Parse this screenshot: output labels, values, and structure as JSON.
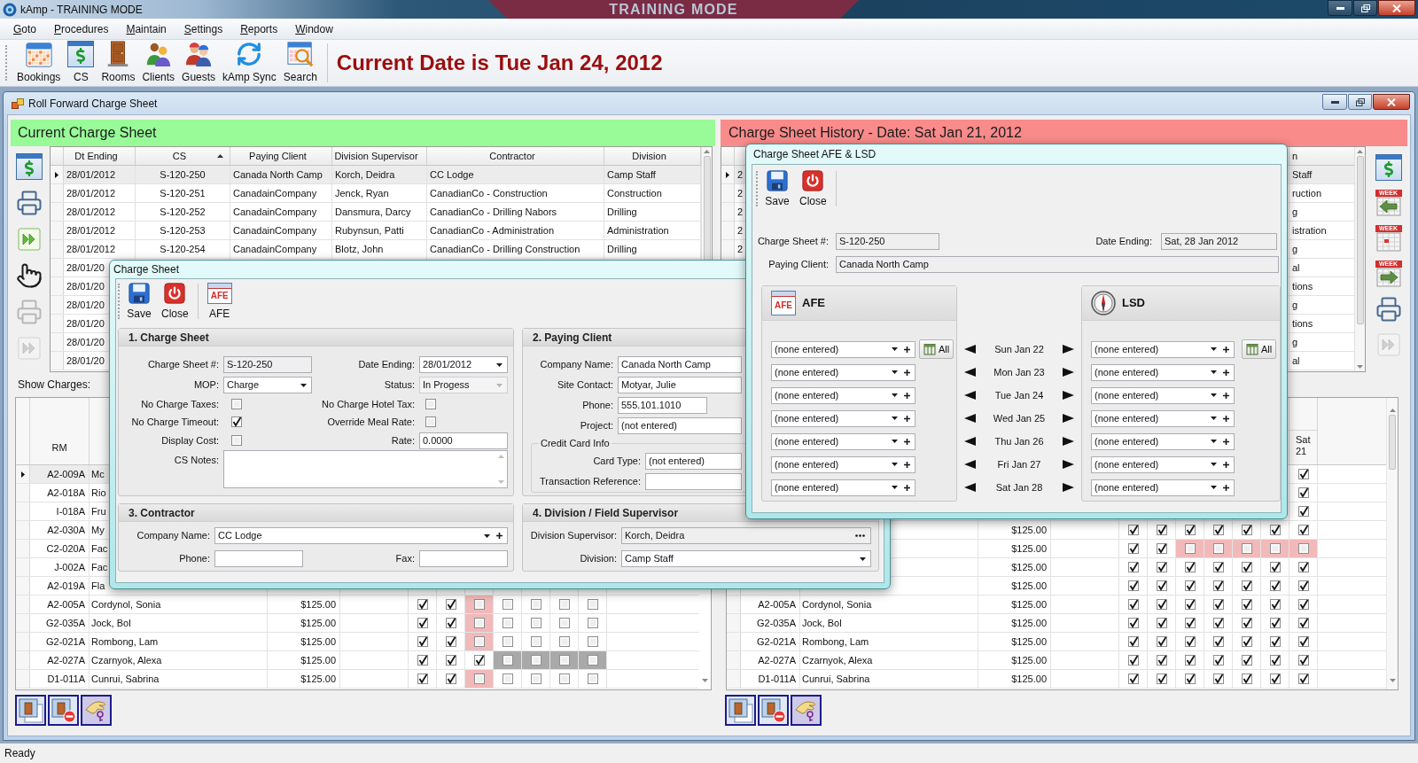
{
  "app": {
    "title": "kAmp - TRAINING MODE",
    "banner": "TRAINING MODE"
  },
  "menu": [
    {
      "label": "Goto"
    },
    {
      "label": "Procedures"
    },
    {
      "label": "Maintain"
    },
    {
      "label": "Settings"
    },
    {
      "label": "Reports"
    },
    {
      "label": "Window"
    }
  ],
  "toolbar": [
    {
      "kind": "calendar",
      "label": "Bookings"
    },
    {
      "kind": "sheet",
      "label": "CS"
    },
    {
      "kind": "door",
      "label": "Rooms"
    },
    {
      "kind": "people",
      "label": "Clients"
    },
    {
      "kind": "worker",
      "label": "Guests"
    },
    {
      "kind": "sync",
      "label": "kAmp Sync"
    },
    {
      "kind": "search",
      "label": "Search"
    }
  ],
  "current_date": "Current Date is Tue Jan 24, 2012",
  "child_window": {
    "title": "Roll Forward Charge Sheet"
  },
  "current_panel": {
    "title": "Current Charge Sheet",
    "side_tools": [
      {
        "kind": "sheet",
        "disabled": false
      },
      {
        "kind": "printer",
        "disabled": false
      },
      {
        "kind": "forward",
        "disabled": false
      },
      {
        "kind": "hand",
        "disabled": false
      },
      {
        "kind": "printer",
        "disabled": true
      },
      {
        "kind": "forward",
        "disabled": true
      }
    ],
    "table": {
      "columns": [
        {
          "label": "Dt Ending",
          "sorted": false
        },
        {
          "label": "CS",
          "sorted": true
        },
        {
          "label": "Paying Client",
          "sorted": false
        },
        {
          "label": "Division Supervisor",
          "sorted": false
        },
        {
          "label": "Contractor",
          "sorted": false
        },
        {
          "label": "Division",
          "sorted": false
        }
      ],
      "rows": [
        {
          "selected": true,
          "cells": [
            "28/01/2012",
            "S-120-250",
            "Canada North Camp",
            "Korch, Deidra",
            "CC Lodge",
            "Camp Staff"
          ]
        },
        {
          "selected": false,
          "cells": [
            "28/01/2012",
            "S-120-251",
            "CanadainCompany",
            "Jenck, Ryan",
            "CanadianCo - Construction",
            "Construction"
          ]
        },
        {
          "selected": false,
          "cells": [
            "28/01/2012",
            "S-120-252",
            "CanadainCompany",
            "Dansmura, Darcy",
            "CanadianCo - Drilling Nabors",
            "Drilling"
          ]
        },
        {
          "selected": false,
          "cells": [
            "28/01/2012",
            "S-120-253",
            "CanadainCompany",
            "Rubynsun, Patti",
            "CanadianCo - Administration",
            "Administration"
          ]
        },
        {
          "selected": false,
          "cells": [
            "28/01/2012",
            "S-120-254",
            "CanadainCompany",
            "Blotz, John",
            "CanadianCo - Drilling Construction",
            "Drilling"
          ]
        },
        {
          "selected": false,
          "cells": [
            "28/01/20"
          ]
        },
        {
          "selected": false,
          "cells": [
            "28/01/20"
          ]
        },
        {
          "selected": false,
          "cells": [
            "28/01/20"
          ]
        },
        {
          "selected": false,
          "cells": [
            "28/01/20"
          ]
        },
        {
          "selected": false,
          "cells": [
            "28/01/20"
          ]
        },
        {
          "selected": false,
          "cells": [
            "28/01/20"
          ]
        }
      ]
    },
    "show_charges": "Show Charges:",
    "grid": {
      "rm_header": "RM",
      "rows": [
        {
          "selected": true,
          "rm": "A2-009A",
          "name": "Mc"
        },
        {
          "selected": false,
          "rm": "A2-018A",
          "name": "Rio"
        },
        {
          "selected": false,
          "rm": "I-018A",
          "name": "Fru"
        },
        {
          "selected": false,
          "rm": "A2-030A",
          "name": "My"
        },
        {
          "selected": false,
          "rm": "C2-020A",
          "name": "Fac"
        },
        {
          "selected": false,
          "rm": "J-002A",
          "name": "Fac"
        },
        {
          "selected": false,
          "rm": "A2-019A",
          "name": "Fla"
        },
        {
          "selected": false,
          "rm": "A2-005A",
          "name": "Cordynol, Sonia",
          "amount": "$125.00",
          "checks": [
            {
              "checked": true,
              "flagged": false,
              "disabled": false
            },
            {
              "checked": true,
              "flagged": false,
              "disabled": false
            },
            {
              "checked": false,
              "flagged": true,
              "disabled": false
            },
            {
              "checked": false,
              "flagged": false,
              "disabled": false
            },
            {
              "checked": false,
              "flagged": false,
              "disabled": false
            },
            {
              "checked": false,
              "flagged": false,
              "disabled": false
            },
            {
              "checked": false,
              "flagged": false,
              "disabled": false
            }
          ]
        },
        {
          "selected": false,
          "rm": "G2-035A",
          "name": "Jock, Bol",
          "amount": "$125.00",
          "checks": [
            {
              "checked": true,
              "flagged": false,
              "disabled": false
            },
            {
              "checked": true,
              "flagged": false,
              "disabled": false
            },
            {
              "checked": false,
              "flagged": true,
              "disabled": false
            },
            {
              "checked": false,
              "flagged": false,
              "disabled": false
            },
            {
              "checked": false,
              "flagged": false,
              "disabled": false
            },
            {
              "checked": false,
              "flagged": false,
              "disabled": false
            },
            {
              "checked": false,
              "flagged": false,
              "disabled": false
            }
          ]
        },
        {
          "selected": false,
          "rm": "G2-021A",
          "name": "Rombong, Lam",
          "amount": "$125.00",
          "checks": [
            {
              "checked": true,
              "flagged": false,
              "disabled": false
            },
            {
              "checked": true,
              "flagged": false,
              "disabled": false
            },
            {
              "checked": false,
              "flagged": true,
              "disabled": false
            },
            {
              "checked": false,
              "flagged": false,
              "disabled": false
            },
            {
              "checked": false,
              "flagged": false,
              "disabled": false
            },
            {
              "checked": false,
              "flagged": false,
              "disabled": false
            },
            {
              "checked": false,
              "flagged": false,
              "disabled": false
            }
          ]
        },
        {
          "selected": false,
          "rm": "A2-027A",
          "name": "Czarnyok, Alexa",
          "amount": "$125.00",
          "checks": [
            {
              "checked": true,
              "flagged": false,
              "disabled": false
            },
            {
              "checked": true,
              "flagged": false,
              "disabled": false
            },
            {
              "checked": true,
              "flagged": false,
              "disabled": false
            },
            {
              "checked": false,
              "flagged": false,
              "disabled": true
            },
            {
              "checked": false,
              "flagged": false,
              "disabled": true
            },
            {
              "checked": false,
              "flagged": false,
              "disabled": true
            },
            {
              "checked": false,
              "flagged": false,
              "disabled": true
            }
          ]
        },
        {
          "selected": false,
          "rm": "D1-011A",
          "name": "Cunrui, Sabrina",
          "amount": "$125.00",
          "checks": [
            {
              "checked": true,
              "flagged": false,
              "disabled": false
            },
            {
              "checked": true,
              "flagged": false,
              "disabled": false
            },
            {
              "checked": false,
              "flagged": true,
              "disabled": false
            },
            {
              "checked": false,
              "flagged": false,
              "disabled": false
            },
            {
              "checked": false,
              "flagged": false,
              "disabled": false
            },
            {
              "checked": false,
              "flagged": false,
              "disabled": false
            },
            {
              "checked": false,
              "flagged": false,
              "disabled": false
            }
          ]
        }
      ]
    }
  },
  "history_panel": {
    "title": "Charge Sheet History - Date: Sat Jan 21, 2012",
    "side_tools": [
      {
        "kind": "sheet",
        "disabled": false
      },
      {
        "kind": "week-back",
        "label": "WEEK",
        "disabled": false
      },
      {
        "kind": "week",
        "label": "WEEK",
        "disabled": false
      },
      {
        "kind": "week-forward",
        "label": "WEEK",
        "disabled": false
      },
      {
        "kind": "printer",
        "disabled": false
      },
      {
        "kind": "forward",
        "disabled": true
      }
    ],
    "table": {
      "division_header": "n",
      "rows": [
        {
          "selected": true,
          "dt_ending": "2",
          "division": "Staff"
        },
        {
          "selected": false,
          "dt_ending": "2",
          "division": "ruction"
        },
        {
          "selected": false,
          "dt_ending": "2",
          "division": "g"
        },
        {
          "selected": false,
          "dt_ending": "2",
          "division": "istration"
        },
        {
          "selected": false,
          "dt_ending": "2",
          "division": "g"
        },
        {
          "division": "al"
        },
        {
          "division": "tions"
        },
        {
          "division": "g"
        },
        {
          "division": "tions"
        },
        {
          "division": "g"
        },
        {
          "division": "al"
        }
      ]
    },
    "grid": {
      "day_header": "Sat 21",
      "rows": [
        {
          "checks": [
            {
              "checked": true,
              "flagged": false,
              "disabled": false
            }
          ]
        },
        {
          "checks": [
            {
              "checked": true,
              "flagged": false,
              "disabled": false
            }
          ]
        },
        {
          "checks": [
            {
              "checked": true,
              "flagged": false,
              "disabled": false
            }
          ]
        },
        {
          "amount": "$125.00",
          "checks": [
            {
              "checked": true,
              "flagged": false,
              "disabled": false
            },
            {
              "checked": true,
              "flagged": false,
              "disabled": false
            },
            {
              "checked": true,
              "flagged": false,
              "disabled": false
            },
            {
              "checked": true,
              "flagged": false,
              "disabled": false
            },
            {
              "checked": true,
              "flagged": false,
              "disabled": false
            },
            {
              "checked": true,
              "flagged": false,
              "disabled": false
            },
            {
              "checked": true,
              "flagged": false,
              "disabled": false
            }
          ]
        },
        {
          "amount": "$125.00",
          "checks": [
            {
              "checked": true,
              "flagged": false,
              "disabled": false
            },
            {
              "checked": true,
              "flagged": false,
              "disabled": false
            },
            {
              "checked": false,
              "flagged": true,
              "disabled": false
            },
            {
              "checked": false,
              "flagged": true,
              "disabled": false
            },
            {
              "checked": false,
              "flagged": true,
              "disabled": false
            },
            {
              "checked": false,
              "flagged": true,
              "disabled": false
            },
            {
              "checked": false,
              "flagged": true,
              "disabled": false
            }
          ]
        },
        {
          "amount": "$125.00",
          "checks": [
            {
              "checked": true,
              "flagged": false,
              "disabled": false
            },
            {
              "checked": true,
              "flagged": false,
              "disabled": false
            },
            {
              "checked": true,
              "flagged": false,
              "disabled": false
            },
            {
              "checked": true,
              "flagged": false,
              "disabled": false
            },
            {
              "checked": true,
              "flagged": false,
              "disabled": false
            },
            {
              "checked": true,
              "flagged": false,
              "disabled": false
            },
            {
              "checked": true,
              "flagged": false,
              "disabled": false
            }
          ]
        },
        {
          "amount": "$125.00",
          "checks": [
            {
              "checked": true,
              "flagged": false,
              "disabled": false
            },
            {
              "checked": true,
              "flagged": false,
              "disabled": false
            },
            {
              "checked": true,
              "flagged": false,
              "disabled": false
            },
            {
              "checked": true,
              "flagged": false,
              "disabled": false
            },
            {
              "checked": true,
              "flagged": false,
              "disabled": false
            },
            {
              "checked": true,
              "flagged": false,
              "disabled": false
            },
            {
              "checked": true,
              "flagged": false,
              "disabled": false
            }
          ]
        },
        {
          "selected": false,
          "rm": "A2-005A",
          "name": "Cordynol, Sonia",
          "amount": "$125.00",
          "checks": [
            {
              "checked": true,
              "flagged": false,
              "disabled": false
            },
            {
              "checked": true,
              "flagged": false,
              "disabled": false
            },
            {
              "checked": true,
              "flagged": false,
              "disabled": false
            },
            {
              "checked": true,
              "flagged": false,
              "disabled": false
            },
            {
              "checked": true,
              "flagged": false,
              "disabled": false
            },
            {
              "checked": true,
              "flagged": false,
              "disabled": false
            },
            {
              "checked": true,
              "flagged": false,
              "disabled": false
            }
          ]
        },
        {
          "selected": false,
          "rm": "G2-035A",
          "name": "Jock, Bol",
          "amount": "$125.00",
          "checks": [
            {
              "checked": true,
              "flagged": false,
              "disabled": false
            },
            {
              "checked": true,
              "flagged": false,
              "disabled": false
            },
            {
              "checked": true,
              "flagged": false,
              "disabled": false
            },
            {
              "checked": true,
              "flagged": false,
              "disabled": false
            },
            {
              "checked": true,
              "flagged": false,
              "disabled": false
            },
            {
              "checked": true,
              "flagged": false,
              "disabled": false
            },
            {
              "checked": true,
              "flagged": false,
              "disabled": false
            }
          ]
        },
        {
          "selected": false,
          "rm": "G2-021A",
          "name": "Rombong, Lam",
          "amount": "$125.00",
          "checks": [
            {
              "checked": true,
              "flagged": false,
              "disabled": false
            },
            {
              "checked": true,
              "flagged": false,
              "disabled": false
            },
            {
              "checked": true,
              "flagged": false,
              "disabled": false
            },
            {
              "checked": true,
              "flagged": false,
              "disabled": false
            },
            {
              "checked": true,
              "flagged": false,
              "disabled": false
            },
            {
              "checked": true,
              "flagged": false,
              "disabled": false
            },
            {
              "checked": true,
              "flagged": false,
              "disabled": false
            }
          ]
        },
        {
          "selected": false,
          "rm": "A2-027A",
          "name": "Czarnyok, Alexa",
          "amount": "$125.00",
          "checks": [
            {
              "checked": true,
              "flagged": false,
              "disabled": false
            },
            {
              "checked": true,
              "flagged": false,
              "disabled": false
            },
            {
              "checked": true,
              "flagged": false,
              "disabled": false
            },
            {
              "checked": true,
              "flagged": false,
              "disabled": false
            },
            {
              "checked": true,
              "flagged": false,
              "disabled": false
            },
            {
              "checked": true,
              "flagged": false,
              "disabled": false
            },
            {
              "checked": true,
              "flagged": false,
              "disabled": false
            }
          ]
        },
        {
          "selected": false,
          "rm": "D1-011A",
          "name": "Cunrui, Sabrina",
          "amount": "$125.00",
          "checks": [
            {
              "checked": true,
              "flagged": false,
              "disabled": false
            },
            {
              "checked": true,
              "flagged": false,
              "disabled": false
            },
            {
              "checked": true,
              "flagged": false,
              "disabled": false
            },
            {
              "checked": true,
              "flagged": false,
              "disabled": false
            },
            {
              "checked": true,
              "flagged": false,
              "disabled": false
            },
            {
              "checked": true,
              "flagged": false,
              "disabled": false
            },
            {
              "checked": true,
              "flagged": false,
              "disabled": false
            }
          ]
        }
      ]
    }
  },
  "charge_sheet_dialog": {
    "title": "Charge Sheet",
    "toolbar": [
      {
        "kind": "save",
        "label": "Save"
      },
      {
        "kind": "close",
        "label": "Close"
      },
      {
        "kind": "afe",
        "label": "AFE",
        "icon_text": "AFE"
      }
    ],
    "section_1": {
      "title": "1. Charge Sheet",
      "charge_sheet_no": {
        "label": "Charge Sheet #:",
        "value": "S-120-250",
        "readonly": true
      },
      "date_ending": {
        "label": "Date Ending:",
        "value": "28/01/2012"
      },
      "mop": {
        "label": "MOP:",
        "value": "Charge"
      },
      "status": {
        "label": "Status:",
        "value": "In Progess",
        "disabled": true
      },
      "no_charge_taxes": {
        "label": "No Charge Taxes:",
        "checked": false
      },
      "no_charge_hotel_tax": {
        "label": "No Charge Hotel Tax:",
        "checked": false
      },
      "no_charge_timeout": {
        "label": "No Charge Timeout:",
        "checked": true
      },
      "override_meal_rate": {
        "label": "Override Meal Rate:",
        "checked": false
      },
      "display_cost": {
        "label": "Display Cost:",
        "checked": false
      },
      "rate": {
        "label": "Rate:",
        "value": "0.0000"
      },
      "cs_notes": {
        "label": "CS Notes:"
      }
    },
    "section_2": {
      "title": "2. Paying Client",
      "company_name": {
        "label": "Company Name:",
        "value": "Canada North Camp"
      },
      "site_contact": {
        "label": "Site Contact:",
        "value": "Motyar, Julie"
      },
      "phone": {
        "label": "Phone:",
        "value": "555.101.1010"
      },
      "project": {
        "label": "Project:",
        "value": "(not entered)"
      },
      "credit_card": {
        "title": "Credit Card Info",
        "card_type": {
          "label": "Card Type:",
          "value": "(not entered)"
        },
        "transaction_reference": {
          "label": "Transaction Reference:"
        }
      }
    },
    "section_3": {
      "title": "3. Contractor",
      "company_name": {
        "label": "Company Name:",
        "value": "CC Lodge"
      },
      "phone": {
        "label": "Phone:"
      },
      "fax": {
        "label": "Fax:"
      }
    },
    "section_4": {
      "title": "4. Division / Field Supervisor",
      "division_supervisor": {
        "label": "Division Supervisor:",
        "value": "Korch, Deidra",
        "readonly": true
      },
      "division": {
        "label": "Division:",
        "value": "Camp Staff"
      }
    }
  },
  "afe_dialog": {
    "title": "Charge Sheet AFE & LSD",
    "toolbar": [
      {
        "kind": "save",
        "label": "Save"
      },
      {
        "kind": "close",
        "label": "Close"
      }
    ],
    "charge_sheet_no": {
      "label": "Charge Sheet #:",
      "value": "S-120-250",
      "readonly": true
    },
    "date_ending": {
      "label": "Date Ending:",
      "value": "Sat, 28 Jan 2012",
      "readonly": true
    },
    "paying_client": {
      "label": "Paying Client:",
      "value": "Canada North Camp",
      "readonly": true
    },
    "afe": {
      "kind": "afe",
      "title": "AFE",
      "icon_text": "AFE",
      "all_button": "All",
      "entries": [
        "(none entered)",
        "(none entered)",
        "(none entered)",
        "(none entered)",
        "(none entered)",
        "(none entered)",
        "(none entered)"
      ]
    },
    "days": [
      "Sun Jan 22",
      "Mon Jan 23",
      "Tue Jan 24",
      "Wed Jan 25",
      "Thu Jan 26",
      "Fri Jan 27",
      "Sat Jan 28"
    ],
    "lsd": {
      "kind": "lsd",
      "title": "LSD",
      "all_button": "All",
      "entries": [
        "(none entered)",
        "(none entered)",
        "(none entered)",
        "(none entered)",
        "(none entered)",
        "(none entered)",
        "(none entered)"
      ]
    }
  },
  "status_bar": "Ready"
}
